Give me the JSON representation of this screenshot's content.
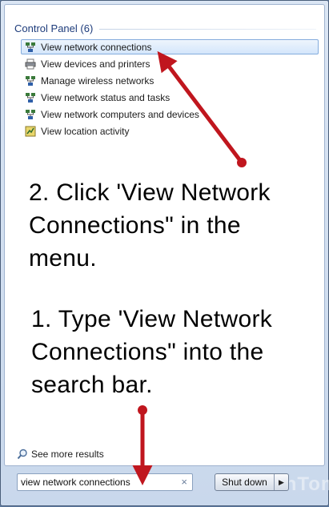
{
  "section": {
    "title": "Control Panel (6)"
  },
  "results": [
    {
      "label": "View network connections",
      "icon": "network-icon",
      "selected": true
    },
    {
      "label": "View devices and printers",
      "icon": "printer-icon"
    },
    {
      "label": "Manage wireless networks",
      "icon": "network-icon"
    },
    {
      "label": "View network status and tasks",
      "icon": "network-icon"
    },
    {
      "label": "View network computers and devices",
      "icon": "network-icon"
    },
    {
      "label": "View location activity",
      "icon": "location-icon"
    }
  ],
  "annotations": {
    "step2": "2. Click 'View Network Connections\" in the menu.",
    "step1": "1. Type 'View Network Connections\" into the search bar."
  },
  "see_more": {
    "label": "See more results"
  },
  "search": {
    "value": "view network connections",
    "clear": "×"
  },
  "shutdown": {
    "label": "Shut down",
    "arrow": "▶"
  },
  "watermark": {
    "text": "LearnTomato"
  },
  "colors": {
    "arrow": "#c0161e",
    "title": "#1e3c7b",
    "selection": "#d4e6fb"
  }
}
